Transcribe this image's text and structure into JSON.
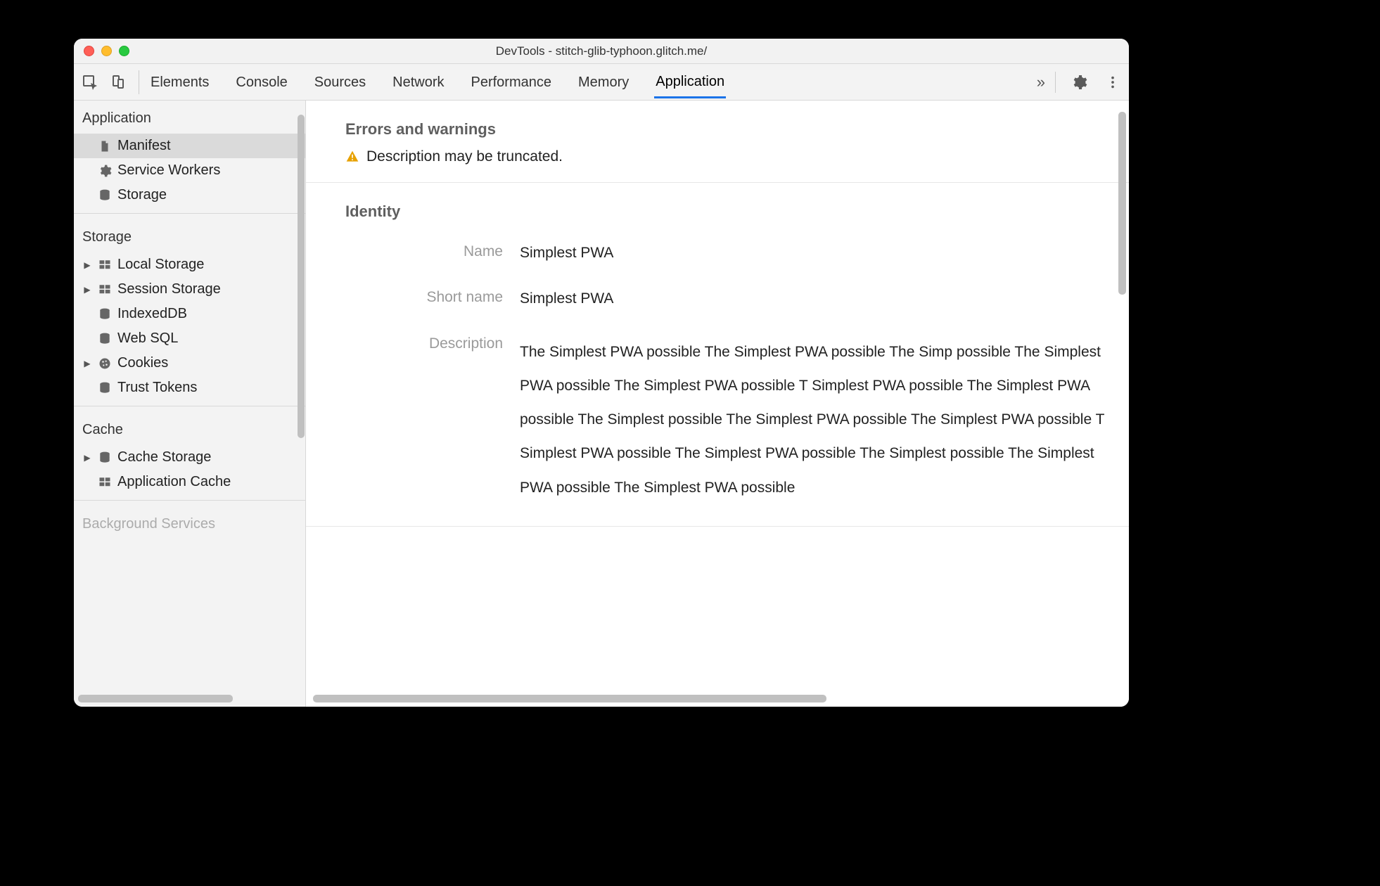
{
  "window": {
    "title": "DevTools - stitch-glib-typhoon.glitch.me/"
  },
  "toolbar": {
    "tabs": [
      "Elements",
      "Console",
      "Sources",
      "Network",
      "Performance",
      "Memory",
      "Application"
    ],
    "active_tab_index": 6,
    "more_glyph": "»"
  },
  "sidebar": {
    "sections": [
      {
        "title": "Application",
        "items": [
          {
            "label": "Manifest",
            "icon": "file-icon",
            "selected": true,
            "hasChildren": false
          },
          {
            "label": "Service Workers",
            "icon": "gear-icon",
            "selected": false,
            "hasChildren": false
          },
          {
            "label": "Storage",
            "icon": "database-icon",
            "selected": false,
            "hasChildren": false
          }
        ]
      },
      {
        "title": "Storage",
        "items": [
          {
            "label": "Local Storage",
            "icon": "table-icon",
            "selected": false,
            "hasChildren": true
          },
          {
            "label": "Session Storage",
            "icon": "table-icon",
            "selected": false,
            "hasChildren": true
          },
          {
            "label": "IndexedDB",
            "icon": "database-icon",
            "selected": false,
            "hasChildren": false
          },
          {
            "label": "Web SQL",
            "icon": "database-icon",
            "selected": false,
            "hasChildren": false
          },
          {
            "label": "Cookies",
            "icon": "cookie-icon",
            "selected": false,
            "hasChildren": true
          },
          {
            "label": "Trust Tokens",
            "icon": "database-icon",
            "selected": false,
            "hasChildren": false
          }
        ]
      },
      {
        "title": "Cache",
        "items": [
          {
            "label": "Cache Storage",
            "icon": "database-icon",
            "selected": false,
            "hasChildren": true
          },
          {
            "label": "Application Cache",
            "icon": "table-icon",
            "selected": false,
            "hasChildren": false
          }
        ]
      }
    ],
    "next_faded_title": "Background Services"
  },
  "main": {
    "errors_heading": "Errors and warnings",
    "warning_text": "Description may be truncated.",
    "identity_heading": "Identity",
    "identity": {
      "name_label": "Name",
      "name_value": "Simplest PWA",
      "short_label": "Short name",
      "short_value": "Simplest PWA",
      "desc_label": "Description",
      "desc_value": "The Simplest PWA possible The Simplest PWA possible The Simp possible The Simplest PWA possible The Simplest PWA possible T Simplest PWA possible The Simplest PWA possible The Simplest possible The Simplest PWA possible The Simplest PWA possible T Simplest PWA possible The Simplest PWA possible The Simplest possible The Simplest PWA possible The Simplest PWA possible"
    }
  }
}
